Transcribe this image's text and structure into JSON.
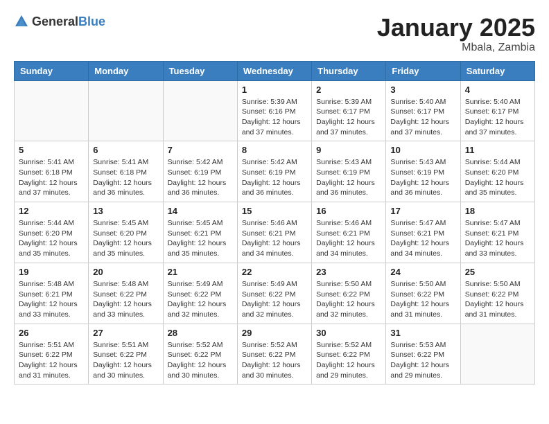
{
  "header": {
    "logo_general": "General",
    "logo_blue": "Blue",
    "month_year": "January 2025",
    "location": "Mbala, Zambia"
  },
  "weekdays": [
    "Sunday",
    "Monday",
    "Tuesday",
    "Wednesday",
    "Thursday",
    "Friday",
    "Saturday"
  ],
  "weeks": [
    [
      {
        "day": "",
        "sunrise": "",
        "sunset": "",
        "daylight": ""
      },
      {
        "day": "",
        "sunrise": "",
        "sunset": "",
        "daylight": ""
      },
      {
        "day": "",
        "sunrise": "",
        "sunset": "",
        "daylight": ""
      },
      {
        "day": "1",
        "sunrise": "Sunrise: 5:39 AM",
        "sunset": "Sunset: 6:16 PM",
        "daylight": "Daylight: 12 hours and 37 minutes."
      },
      {
        "day": "2",
        "sunrise": "Sunrise: 5:39 AM",
        "sunset": "Sunset: 6:17 PM",
        "daylight": "Daylight: 12 hours and 37 minutes."
      },
      {
        "day": "3",
        "sunrise": "Sunrise: 5:40 AM",
        "sunset": "Sunset: 6:17 PM",
        "daylight": "Daylight: 12 hours and 37 minutes."
      },
      {
        "day": "4",
        "sunrise": "Sunrise: 5:40 AM",
        "sunset": "Sunset: 6:17 PM",
        "daylight": "Daylight: 12 hours and 37 minutes."
      }
    ],
    [
      {
        "day": "5",
        "sunrise": "Sunrise: 5:41 AM",
        "sunset": "Sunset: 6:18 PM",
        "daylight": "Daylight: 12 hours and 37 minutes."
      },
      {
        "day": "6",
        "sunrise": "Sunrise: 5:41 AM",
        "sunset": "Sunset: 6:18 PM",
        "daylight": "Daylight: 12 hours and 36 minutes."
      },
      {
        "day": "7",
        "sunrise": "Sunrise: 5:42 AM",
        "sunset": "Sunset: 6:19 PM",
        "daylight": "Daylight: 12 hours and 36 minutes."
      },
      {
        "day": "8",
        "sunrise": "Sunrise: 5:42 AM",
        "sunset": "Sunset: 6:19 PM",
        "daylight": "Daylight: 12 hours and 36 minutes."
      },
      {
        "day": "9",
        "sunrise": "Sunrise: 5:43 AM",
        "sunset": "Sunset: 6:19 PM",
        "daylight": "Daylight: 12 hours and 36 minutes."
      },
      {
        "day": "10",
        "sunrise": "Sunrise: 5:43 AM",
        "sunset": "Sunset: 6:19 PM",
        "daylight": "Daylight: 12 hours and 36 minutes."
      },
      {
        "day": "11",
        "sunrise": "Sunrise: 5:44 AM",
        "sunset": "Sunset: 6:20 PM",
        "daylight": "Daylight: 12 hours and 35 minutes."
      }
    ],
    [
      {
        "day": "12",
        "sunrise": "Sunrise: 5:44 AM",
        "sunset": "Sunset: 6:20 PM",
        "daylight": "Daylight: 12 hours and 35 minutes."
      },
      {
        "day": "13",
        "sunrise": "Sunrise: 5:45 AM",
        "sunset": "Sunset: 6:20 PM",
        "daylight": "Daylight: 12 hours and 35 minutes."
      },
      {
        "day": "14",
        "sunrise": "Sunrise: 5:45 AM",
        "sunset": "Sunset: 6:21 PM",
        "daylight": "Daylight: 12 hours and 35 minutes."
      },
      {
        "day": "15",
        "sunrise": "Sunrise: 5:46 AM",
        "sunset": "Sunset: 6:21 PM",
        "daylight": "Daylight: 12 hours and 34 minutes."
      },
      {
        "day": "16",
        "sunrise": "Sunrise: 5:46 AM",
        "sunset": "Sunset: 6:21 PM",
        "daylight": "Daylight: 12 hours and 34 minutes."
      },
      {
        "day": "17",
        "sunrise": "Sunrise: 5:47 AM",
        "sunset": "Sunset: 6:21 PM",
        "daylight": "Daylight: 12 hours and 34 minutes."
      },
      {
        "day": "18",
        "sunrise": "Sunrise: 5:47 AM",
        "sunset": "Sunset: 6:21 PM",
        "daylight": "Daylight: 12 hours and 33 minutes."
      }
    ],
    [
      {
        "day": "19",
        "sunrise": "Sunrise: 5:48 AM",
        "sunset": "Sunset: 6:21 PM",
        "daylight": "Daylight: 12 hours and 33 minutes."
      },
      {
        "day": "20",
        "sunrise": "Sunrise: 5:48 AM",
        "sunset": "Sunset: 6:22 PM",
        "daylight": "Daylight: 12 hours and 33 minutes."
      },
      {
        "day": "21",
        "sunrise": "Sunrise: 5:49 AM",
        "sunset": "Sunset: 6:22 PM",
        "daylight": "Daylight: 12 hours and 32 minutes."
      },
      {
        "day": "22",
        "sunrise": "Sunrise: 5:49 AM",
        "sunset": "Sunset: 6:22 PM",
        "daylight": "Daylight: 12 hours and 32 minutes."
      },
      {
        "day": "23",
        "sunrise": "Sunrise: 5:50 AM",
        "sunset": "Sunset: 6:22 PM",
        "daylight": "Daylight: 12 hours and 32 minutes."
      },
      {
        "day": "24",
        "sunrise": "Sunrise: 5:50 AM",
        "sunset": "Sunset: 6:22 PM",
        "daylight": "Daylight: 12 hours and 31 minutes."
      },
      {
        "day": "25",
        "sunrise": "Sunrise: 5:50 AM",
        "sunset": "Sunset: 6:22 PM",
        "daylight": "Daylight: 12 hours and 31 minutes."
      }
    ],
    [
      {
        "day": "26",
        "sunrise": "Sunrise: 5:51 AM",
        "sunset": "Sunset: 6:22 PM",
        "daylight": "Daylight: 12 hours and 31 minutes."
      },
      {
        "day": "27",
        "sunrise": "Sunrise: 5:51 AM",
        "sunset": "Sunset: 6:22 PM",
        "daylight": "Daylight: 12 hours and 30 minutes."
      },
      {
        "day": "28",
        "sunrise": "Sunrise: 5:52 AM",
        "sunset": "Sunset: 6:22 PM",
        "daylight": "Daylight: 12 hours and 30 minutes."
      },
      {
        "day": "29",
        "sunrise": "Sunrise: 5:52 AM",
        "sunset": "Sunset: 6:22 PM",
        "daylight": "Daylight: 12 hours and 30 minutes."
      },
      {
        "day": "30",
        "sunrise": "Sunrise: 5:52 AM",
        "sunset": "Sunset: 6:22 PM",
        "daylight": "Daylight: 12 hours and 29 minutes."
      },
      {
        "day": "31",
        "sunrise": "Sunrise: 5:53 AM",
        "sunset": "Sunset: 6:22 PM",
        "daylight": "Daylight: 12 hours and 29 minutes."
      },
      {
        "day": "",
        "sunrise": "",
        "sunset": "",
        "daylight": ""
      }
    ]
  ]
}
